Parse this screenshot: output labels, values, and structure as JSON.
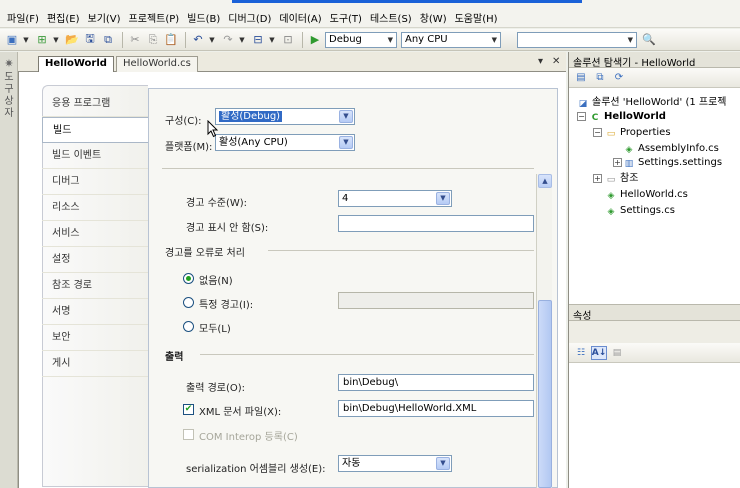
{
  "menu": [
    "파일(F)",
    "편집(E)",
    "보기(V)",
    "프로젝트(P)",
    "빌드(B)",
    "디버그(D)",
    "데이터(A)",
    "도구(T)",
    "테스트(S)",
    "창(W)",
    "도움말(H)"
  ],
  "toolbar": {
    "config_value": "Debug",
    "platform_value": "Any CPU"
  },
  "left_strip": {
    "label": "도구 상자"
  },
  "doc_tabs": {
    "active": "HelloWorld",
    "other": "HelloWorld.cs",
    "dropdown_glyph": "▾",
    "close_glyph": "✕"
  },
  "nav": [
    {
      "label": "응용 프로그램"
    },
    {
      "label": "빌드"
    },
    {
      "label": "빌드 이벤트"
    },
    {
      "label": "디버그"
    },
    {
      "label": "리소스"
    },
    {
      "label": "서비스"
    },
    {
      "label": "설정"
    },
    {
      "label": "참조 경로"
    },
    {
      "label": "서명"
    },
    {
      "label": "보안"
    },
    {
      "label": "게시"
    }
  ],
  "build": {
    "config_label": "구성(C):",
    "config_value": "활성(Debug)",
    "platform_label": "플랫폼(M):",
    "platform_value": "활성(Any CPU)",
    "warning_level_label": "경고 수준(W):",
    "warning_level_value": "4",
    "suppress_label": "경고 표시 안 함(S):",
    "suppress_value": "",
    "treat_warnings_header": "경고를 오류로 처리",
    "radio_none": "없음(N)",
    "radio_specific": "특정 경고(I):",
    "radio_all": "모두(L)",
    "output_header": "출력",
    "output_path_label": "출력 경로(O):",
    "output_path_value": "bin\\Debug\\",
    "xml_doc_label": "XML 문서 파일(X):",
    "xml_doc_value": "bin\\Debug\\HelloWorld.XML",
    "xml_doc_checked": true,
    "com_interop_label": "COM Interop 등록(C)",
    "serialization_label": "serialization 어셈블리 생성(E):",
    "serialization_value": "자동"
  },
  "solution_explorer": {
    "title": "솔루션 탐색기 - HelloWorld",
    "solution": "솔루션 'HelloWorld' (1 프로젝",
    "project": "HelloWorld",
    "properties": "Properties",
    "assemblyinfo": "AssemblyInfo.cs",
    "settings_settings": "Settings.settings",
    "references": "참조",
    "helloworld_cs": "HelloWorld.cs",
    "settings_cs": "Settings.cs"
  },
  "properties_panel": {
    "title": "속성"
  }
}
